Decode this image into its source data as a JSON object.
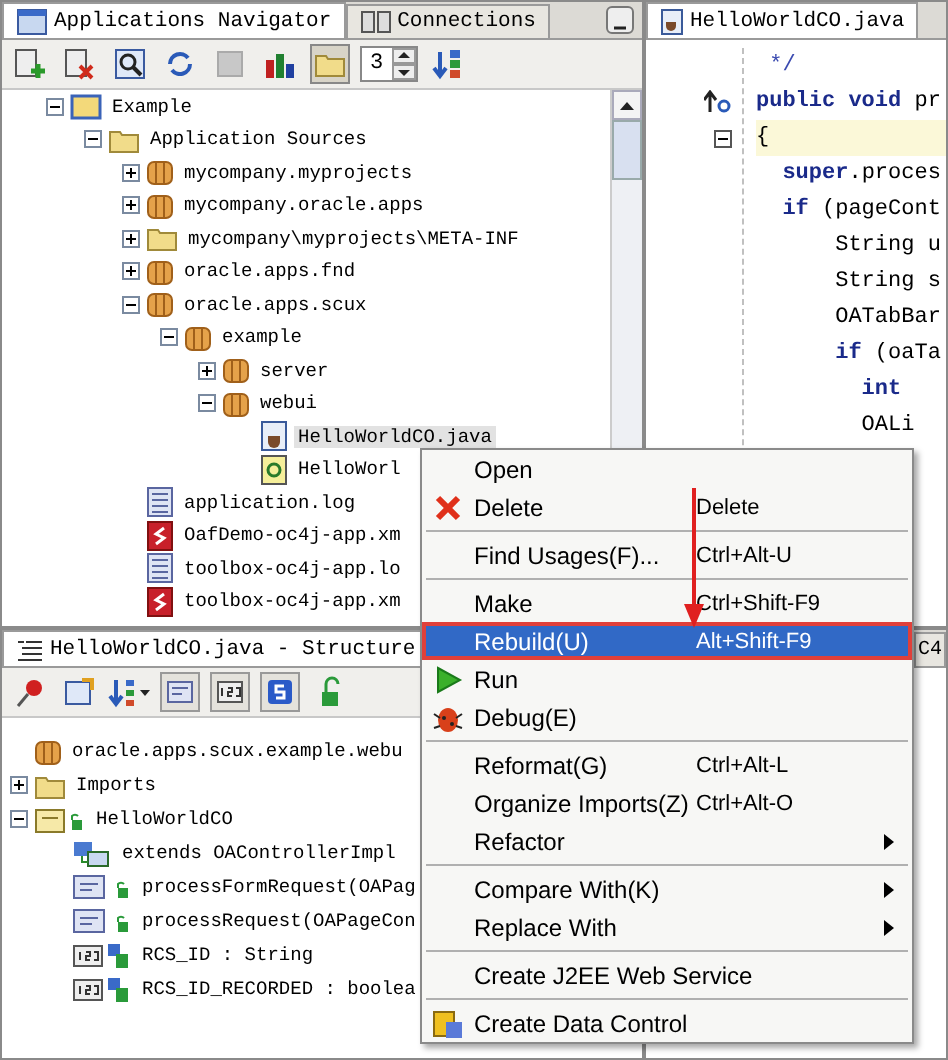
{
  "navigator": {
    "tabs": [
      {
        "label": "Applications Navigator",
        "selected": true
      },
      {
        "label": "Connections",
        "selected": false
      }
    ],
    "folders_toggle": {
      "pressed": true
    },
    "spinner": {
      "value": "3"
    },
    "tree": [
      {
        "label": "Example",
        "kind": "project",
        "expanded": true,
        "selected": false,
        "children": [
          {
            "label": "Application Sources",
            "kind": "folder",
            "expanded": true,
            "selected": false,
            "children": [
              {
                "label": "mycompany.myprojects",
                "kind": "package",
                "expanded": false,
                "selected": false
              },
              {
                "label": "mycompany.oracle.apps",
                "kind": "package",
                "expanded": false,
                "selected": false
              },
              {
                "label": "mycompany\\myprojects\\META-INF",
                "kind": "folder",
                "expanded": false,
                "selected": false
              },
              {
                "label": "oracle.apps.fnd",
                "kind": "package",
                "expanded": false,
                "selected": false
              },
              {
                "label": "oracle.apps.scux",
                "kind": "package",
                "expanded": true,
                "selected": false,
                "children": [
                  {
                    "label": "example",
                    "kind": "package",
                    "expanded": true,
                    "selected": false,
                    "children": [
                      {
                        "label": "server",
                        "kind": "package",
                        "expanded": false,
                        "selected": false
                      },
                      {
                        "label": "webui",
                        "kind": "package",
                        "expanded": true,
                        "selected": false,
                        "children": [
                          {
                            "label": "HelloWorldCO.java",
                            "kind": "java",
                            "selected": true
                          },
                          {
                            "label": "HelloWorl",
                            "kind": "page",
                            "selected": false
                          }
                        ]
                      }
                    ]
                  }
                ]
              },
              {
                "label": "application.log",
                "kind": "log",
                "selected": false
              },
              {
                "label": "OafDemo-oc4j-app.xm",
                "kind": "xml",
                "selected": false
              },
              {
                "label": "toolbox-oc4j-app.lo",
                "kind": "log",
                "selected": false
              },
              {
                "label": "toolbox-oc4j-app.xm",
                "kind": "xml",
                "selected": false
              }
            ]
          }
        ]
      }
    ]
  },
  "editor": {
    "tab": {
      "label": "HelloWorldCO.java",
      "selected": true
    },
    "lines": [
      {
        "kind": "plain",
        "highlighted": false,
        "segments": [
          {
            "text": " */",
            "kind": "comment"
          }
        ]
      },
      {
        "kind": "override",
        "highlighted": false,
        "segments": [
          {
            "text": "public void",
            "kind": "keyword"
          },
          {
            "text": " pr",
            "kind": "plain"
          }
        ]
      },
      {
        "kind": "fold",
        "highlighted": true,
        "segments": [
          {
            "text": "{",
            "kind": "plain"
          }
        ]
      },
      {
        "kind": "plain",
        "highlighted": false,
        "segments": [
          {
            "text": "  super",
            "kind": "keyword"
          },
          {
            "text": ".proces",
            "kind": "plain"
          }
        ]
      },
      {
        "kind": "plain",
        "highlighted": false,
        "segments": [
          {
            "text": "  if",
            "kind": "keyword"
          },
          {
            "text": " (pageCont",
            "kind": "plain"
          }
        ]
      },
      {
        "kind": "plain",
        "highlighted": false,
        "segments": [
          {
            "text": "      String u",
            "kind": "plain"
          }
        ]
      },
      {
        "kind": "plain",
        "highlighted": false,
        "segments": [
          {
            "text": "      String s",
            "kind": "plain"
          }
        ]
      },
      {
        "kind": "plain",
        "highlighted": false,
        "segments": [
          {
            "text": "      OATabBar",
            "kind": "plain"
          }
        ]
      },
      {
        "kind": "plain",
        "highlighted": false,
        "segments": [
          {
            "text": "      if",
            "kind": "keyword"
          },
          {
            "text": " (oaTa",
            "kind": "plain"
          }
        ]
      },
      {
        "kind": "plain",
        "highlighted": false,
        "segments": [
          {
            "text": "        int",
            "kind": "keyword"
          }
        ]
      },
      {
        "kind": "plain",
        "highlighted": false,
        "segments": [
          {
            "text": "        OALi",
            "kind": "plain"
          }
        ]
      }
    ]
  },
  "structure": {
    "tab": {
      "label": "HelloWorldCO.java - Structure",
      "selected": true
    },
    "tree": [
      {
        "label": "oracle.apps.scux.example.webu",
        "kind": "package"
      },
      {
        "label": "Imports",
        "kind": "folder",
        "expanded": false
      },
      {
        "label": "HelloWorldCO",
        "kind": "class",
        "expanded": true,
        "children": [
          {
            "label": "extends OAControllerImpl",
            "kind": "extends"
          },
          {
            "label": "processFormRequest(OAPag",
            "kind": "method"
          },
          {
            "label": "processRequest(OAPageCon",
            "kind": "method"
          },
          {
            "label": "RCS_ID : String",
            "kind": "field"
          },
          {
            "label": "RCS_ID_RECORDED : boolea",
            "kind": "field"
          }
        ]
      }
    ]
  },
  "side_panel": {
    "tab": {
      "label": "C4",
      "selected": false
    }
  },
  "menu": {
    "items": [
      {
        "kind": "item",
        "label": "Open",
        "submenu": false,
        "selected": false
      },
      {
        "kind": "delete",
        "label": "Delete",
        "shortcut": "Delete",
        "submenu": false,
        "selected": false
      },
      {
        "kind": "separator"
      },
      {
        "kind": "item",
        "label": "Find Usages(F)...",
        "shortcut": "Ctrl+Alt-U",
        "submenu": false,
        "selected": false
      },
      {
        "kind": "separator"
      },
      {
        "kind": "item",
        "label": "Make",
        "shortcut": "Ctrl+Shift-F9",
        "submenu": false,
        "selected": false
      },
      {
        "kind": "item",
        "label": "Rebuild(U)",
        "shortcut": "Alt+Shift-F9",
        "submenu": false,
        "selected": true
      },
      {
        "kind": "run",
        "label": "Run",
        "submenu": false,
        "selected": false
      },
      {
        "kind": "debug",
        "label": "Debug(E)",
        "submenu": false,
        "selected": false
      },
      {
        "kind": "separator"
      },
      {
        "kind": "item",
        "label": "Reformat(G)",
        "shortcut": "Ctrl+Alt-L",
        "submenu": false,
        "selected": false
      },
      {
        "kind": "item",
        "label": "Organize Imports(Z)",
        "shortcut": "Ctrl+Alt-O",
        "submenu": false,
        "selected": false
      },
      {
        "kind": "item",
        "label": "Refactor",
        "submenu": true,
        "selected": false
      },
      {
        "kind": "separator"
      },
      {
        "kind": "item",
        "label": "Compare With(K)",
        "submenu": true,
        "selected": false
      },
      {
        "kind": "item",
        "label": "Replace With",
        "submenu": true,
        "selected": false
      },
      {
        "kind": "separator"
      },
      {
        "kind": "item",
        "label": "Create J2EE Web Service",
        "submenu": false,
        "selected": false
      },
      {
        "kind": "separator"
      },
      {
        "kind": "data-control",
        "label": "Create Data Control",
        "submenu": false,
        "selected": false
      }
    ]
  }
}
